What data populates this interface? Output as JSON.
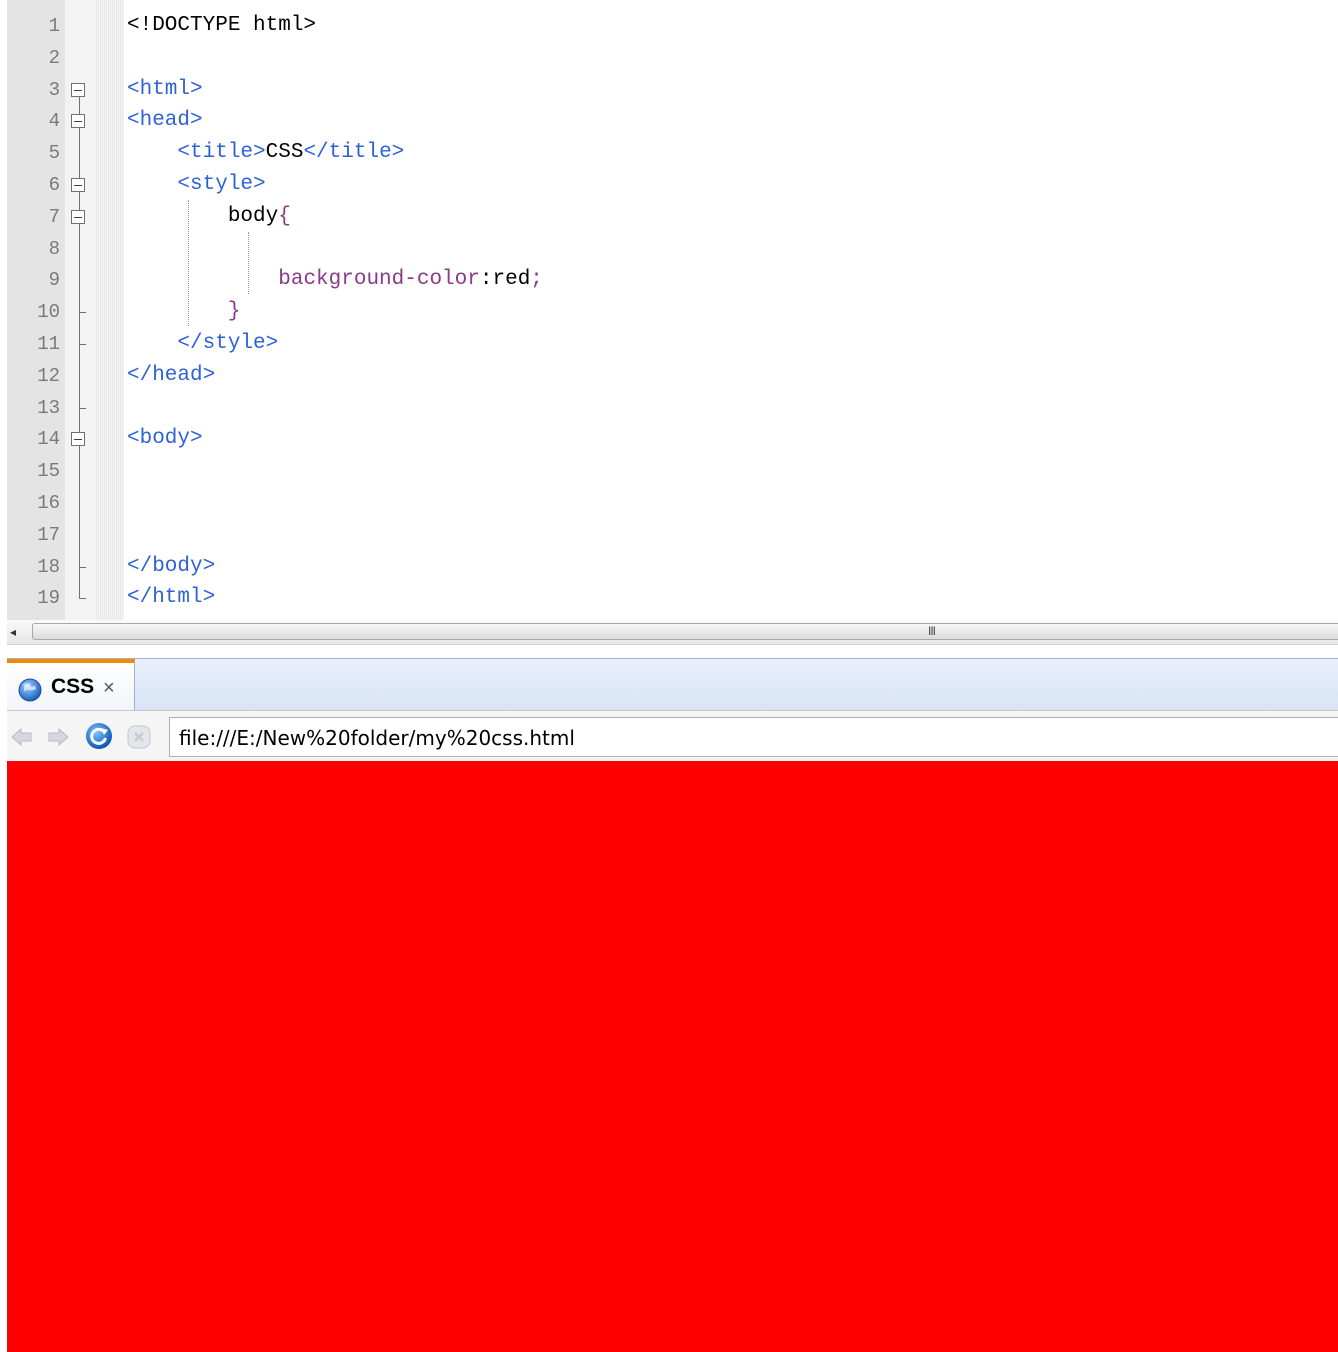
{
  "editor": {
    "lines": [
      {
        "num": "1",
        "indent": "",
        "tokens": [
          [
            "<!DOCTYPE html>",
            "plain"
          ]
        ]
      },
      {
        "num": "2",
        "indent": "",
        "tokens": []
      },
      {
        "num": "3",
        "indent": "",
        "tokens": [
          [
            "<html>",
            "tag"
          ]
        ]
      },
      {
        "num": "4",
        "indent": "",
        "tokens": [
          [
            "<head>",
            "tag"
          ]
        ]
      },
      {
        "num": "5",
        "indent": "    ",
        "tokens": [
          [
            "<title>",
            "tag"
          ],
          [
            "CSS",
            "plain"
          ],
          [
            "</title>",
            "tag"
          ]
        ]
      },
      {
        "num": "6",
        "indent": "    ",
        "tokens": [
          [
            "<style>",
            "tag"
          ]
        ]
      },
      {
        "num": "7",
        "indent": "        ",
        "tokens": [
          [
            "body",
            "plain"
          ],
          [
            "{",
            "brace"
          ]
        ]
      },
      {
        "num": "8",
        "indent": "",
        "tokens": []
      },
      {
        "num": "9",
        "indent": "            ",
        "tokens": [
          [
            "background-color",
            "prop"
          ],
          [
            ":",
            "plain"
          ],
          [
            "red",
            "plain"
          ],
          [
            ";",
            "prop"
          ]
        ]
      },
      {
        "num": "10",
        "indent": "        ",
        "tokens": [
          [
            "}",
            "brace"
          ]
        ]
      },
      {
        "num": "11",
        "indent": "    ",
        "tokens": [
          [
            "</style>",
            "tag"
          ]
        ]
      },
      {
        "num": "12",
        "indent": "",
        "tokens": [
          [
            "</head>",
            "tag"
          ]
        ]
      },
      {
        "num": "13",
        "indent": "",
        "tokens": []
      },
      {
        "num": "14",
        "indent": "",
        "tokens": [
          [
            "<body>",
            "tag"
          ]
        ]
      },
      {
        "num": "15",
        "indent": "",
        "tokens": []
      },
      {
        "num": "16",
        "indent": "",
        "tokens": []
      },
      {
        "num": "17",
        "indent": "",
        "tokens": []
      },
      {
        "num": "18",
        "indent": "",
        "tokens": [
          [
            "</body>",
            "tag"
          ]
        ]
      },
      {
        "num": "19",
        "indent": "",
        "tokens": [
          [
            "</html>",
            "tag"
          ]
        ]
      }
    ],
    "fold_boxes": [
      "3",
      "4",
      "6",
      "7",
      "14"
    ],
    "fold_ends": [
      "10",
      "11",
      "13",
      "18",
      "19"
    ]
  },
  "scrollbar": {
    "left_arrow": "◂",
    "grip": "III"
  },
  "browser": {
    "tab_title": "CSS",
    "tab_close": "×",
    "tab_icon": "globe-icon",
    "nav_icons": [
      "back-arrow-icon",
      "forward-arrow-icon",
      "refresh-icon",
      "stop-icon"
    ],
    "address": "file:///E:/New%20folder/my%20css.html",
    "page_background": "#ff0000"
  },
  "colors": {
    "tag": "#2e62d8",
    "property": "#8a3a8a",
    "text": "#000000",
    "line_number": "#7a7a7a",
    "tab_accent": "#f28a00"
  }
}
